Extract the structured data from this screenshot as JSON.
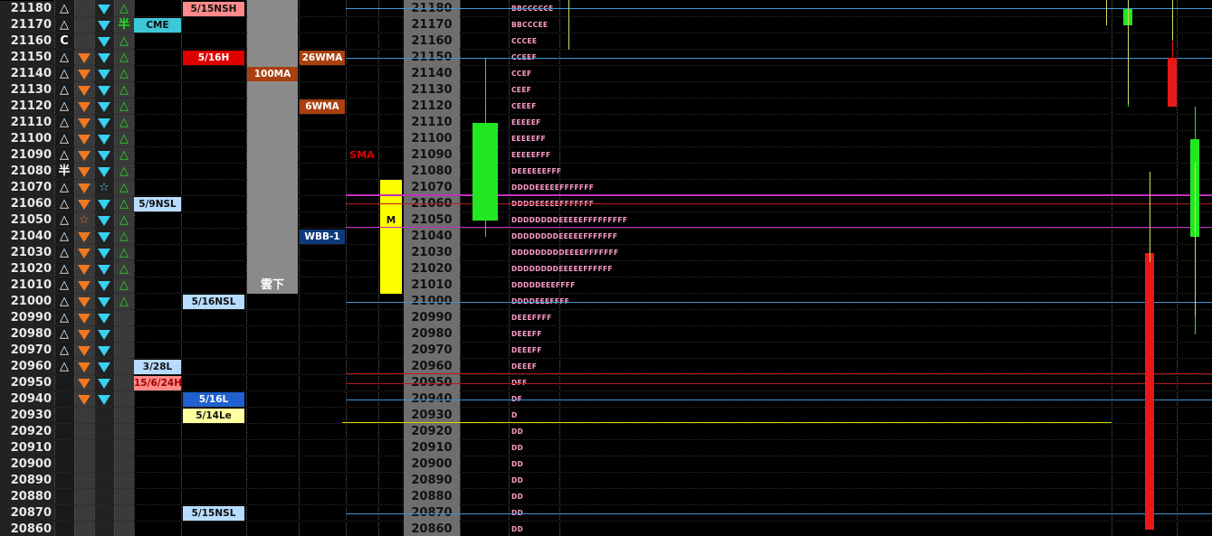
{
  "price_ladder": {
    "levels": [
      21180,
      21170,
      21160,
      21150,
      21140,
      21130,
      21120,
      21110,
      21100,
      21090,
      21080,
      21070,
      21060,
      21050,
      21040,
      21030,
      21020,
      21010,
      21000,
      20990,
      20980,
      20970,
      20960,
      20950,
      20940,
      20930,
      20920,
      20910,
      20900,
      20890,
      20880,
      20870,
      20860
    ],
    "col1_symbols": [
      "△",
      "△",
      "C",
      "△",
      "△",
      "△",
      "△",
      "△",
      "△",
      "△",
      "半",
      "△",
      "△",
      "△",
      "△",
      "△",
      "△",
      "△",
      "△",
      "△",
      "△",
      "△",
      "△",
      "",
      "",
      "",
      "",
      "",
      "",
      "",
      "",
      "",
      ""
    ],
    "col2_symbols": [
      "",
      "",
      "",
      "▼",
      "▼",
      "▼",
      "▼",
      "▼",
      "▼",
      "▼",
      "▼",
      "▼",
      "▼",
      "☆",
      "▼",
      "▼",
      "▼",
      "▼",
      "▼",
      "▼",
      "▼",
      "▼",
      "▼",
      "▼",
      "▼",
      "",
      "",
      "",
      "",
      "",
      "",
      "",
      ""
    ],
    "col3_symbols": [
      "▼",
      "▼",
      "▼",
      "▼",
      "▼",
      "▼",
      "▼",
      "▼",
      "▼",
      "▼",
      "▼",
      "☆",
      "▼",
      "▼",
      "▼",
      "▼",
      "▼",
      "▼",
      "▼",
      "▼",
      "▼",
      "▼",
      "▼",
      "▼",
      "▼",
      "",
      "",
      "",
      "",
      "",
      "",
      "",
      ""
    ],
    "col4_symbols": [
      "△",
      "半",
      "△",
      "△",
      "△",
      "△",
      "△",
      "△",
      "△",
      "△",
      "△",
      "△",
      "△",
      "△",
      "△",
      "△",
      "△",
      "△",
      "△",
      "",
      "",
      "",
      "",
      "",
      "",
      "",
      "",
      "",
      "",
      "",
      "",
      "",
      ""
    ]
  },
  "labels": {
    "cme": "CME",
    "nsl_5_9": "5/9NSL",
    "l_3_28": "3/28L",
    "date_15_6_24": "15/6/24H",
    "nsh_5_15": "5/15NSH",
    "h_5_16": "5/16H",
    "nsl_5_16": "5/16NSL",
    "l_5_16": "5/16L",
    "le_5_14": "5/14Le",
    "nsl_5_15": "5/15NSL",
    "ma100": "100MA",
    "wma26": "26WMA",
    "wma6": "6WMA",
    "kumo": "雲下",
    "sma": "SMA",
    "wbb": "WBB-1",
    "m": "M"
  },
  "tpo_rows": [
    "BBCCCCCE",
    "BBCCCEE",
    "CCCEE",
    "CCEEF",
    "CCEF",
    "CEEF",
    "CEEEF",
    "EEEEEF",
    "EEEEEFF",
    "EEEEEFFF",
    "DEEEEEEFFF",
    "DDDDEEEEEFFFFFFF",
    "DDDDEEEEEFFFFFFF",
    "DDDDDDDDEEEEEFFFFFFFFF",
    "DDDDDDDDEEEEEFFFFFFF",
    "DDDDDDDDDEEEEFFFFFFF",
    "DDDDDDDDEEEEEFFFFFF",
    "DDDDDEEEFFFF",
    "DDDDEEEFFFF",
    "DEEEFFFF",
    "DEEEFF",
    "DEEEFF",
    "DEEEF",
    "DFF",
    "DF",
    "D",
    "DD",
    "DD",
    "DD",
    "DD",
    "DD",
    "DD",
    "DD"
  ],
  "colors": {
    "blue_label": "#2060d0",
    "light_blue_label": "#b8dcff",
    "pink_label": "#ff8a8a",
    "red_label": "#e00000",
    "yellow_label": "#ffffa0",
    "brown_label": "#a84010",
    "navy_label": "#0f3a7a",
    "teal_label": "#3cc8d8",
    "green_candle": "#22e822",
    "red_candle": "#e81818",
    "hline_blue": "#3f95d8",
    "hline_magenta": "#c030c0",
    "hline_red": "#b81818",
    "hline_yellow": "#d8d800"
  }
}
